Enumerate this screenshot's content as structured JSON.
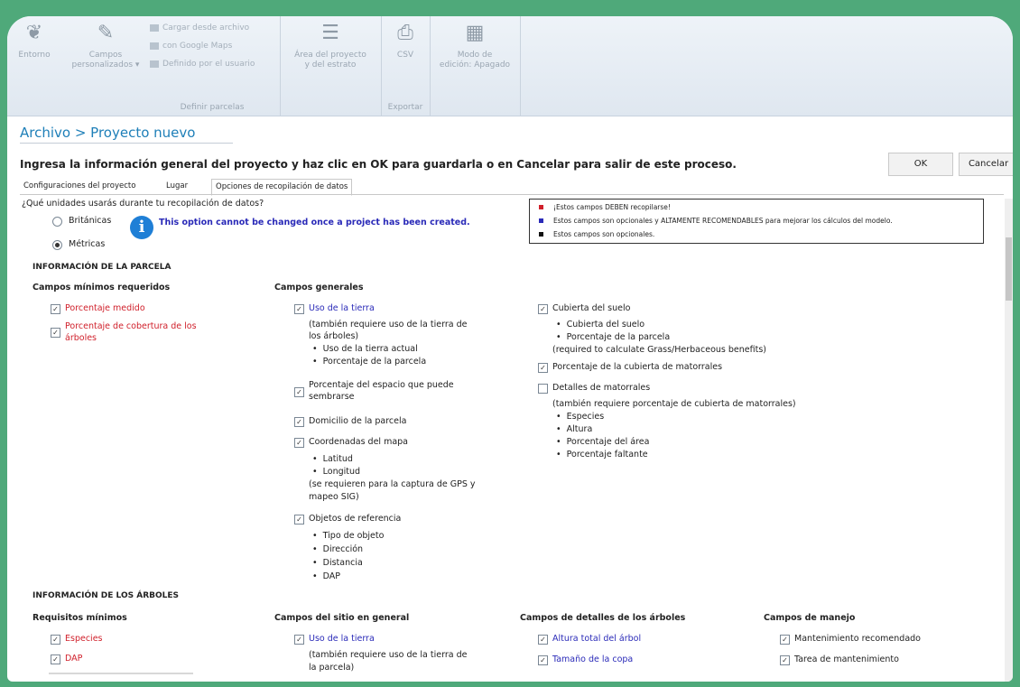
{
  "ribbon": {
    "btn_entorno": "Entorno",
    "btn_campos_line1": "Campos",
    "btn_campos_line2": "personalizados ▾",
    "definir_items": [
      "Cargar desde archivo",
      "con Google Maps",
      "Definido por el usuario"
    ],
    "definir_label": "Definir parcelas",
    "btn_area_line1": "Área del proyecto",
    "btn_area_line2": "y del estrato",
    "btn_csv": "CSV",
    "exportar_label": "Exportar",
    "btn_modo_line1": "Modo de",
    "btn_modo_line2": "edición: Apagado"
  },
  "breadcrumb": "Archivo > Proyecto nuevo",
  "instruction": "Ingresa la información general del proyecto y haz clic en OK para guardarla o en Cancelar para salir de este proceso.",
  "ok_label": "OK",
  "cancel_label": "Cancelar",
  "tabs": [
    "Configuraciones del proyecto",
    "Lugar",
    "Opciones de recopilación de datos"
  ],
  "units": {
    "question_part1": "¿Qué unidades usarás durante tu recopilación de datos?",
    "question": "¿Qué unidades usarás durante tu recopilación de datos?",
    "british": "Británicas",
    "metric": "Métricas",
    "selected": "Métricas",
    "notice": "This option cannot be changed once a project has been created."
  },
  "legend": [
    {
      "text": "¡Estos campos DEBEN recopilarse!",
      "color": "#d0202b"
    },
    {
      "text": "Estos campos son opcionales y ALTAMENTE RECOMENDABLES para mejorar los cálculos del modelo.",
      "color": "#2a2ab8"
    },
    {
      "text": "Estos campos son opcionales.",
      "color": "#111111"
    }
  ],
  "plot": {
    "heading": "INFORMACIÓN DE LA PARCELA",
    "min_heading": "Campos mínimos requeridos",
    "porcentaje_medido": "Porcentaje medido",
    "cobertura_1": "Porcentaje de cobertura de los",
    "cobertura_2": "árboles",
    "general_heading": "Campos generales",
    "uso_tierra": "Uso de la tierra",
    "uso_note_1": "(también requiere uso de la tierra de",
    "uso_note_2": "los árboles)",
    "uso_b1": "Uso de la tierra actual",
    "uso_b2": "Porcentaje de la parcela",
    "espacio_1": "Porcentaje del espacio que puede",
    "espacio_2": "sembrarse",
    "domicilio": "Domicilio de la parcela",
    "coordenadas": "Coordenadas del mapa",
    "latitud": "Latitud",
    "longitud": "Longitud",
    "coord_note_1": "(se requieren para la captura de GPS y",
    "coord_note_2": "mapeo SIG)",
    "objetos": "Objetos de referencia",
    "obj_b1": "Tipo de objeto",
    "obj_b2": "Dirección",
    "obj_b3": "Distancia",
    "obj_b4": "DAP",
    "cubierta": "Cubierta del suelo",
    "cub_b1": "Cubierta del suelo",
    "cub_b2": "Porcentaje de la parcela",
    "cub_note": "(required to calculate Grass/Herbaceous benefits)",
    "matorrales_pct": "Porcentaje de la cubierta de matorrales",
    "detalles_mat": "Detalles de matorrales",
    "det_note": "(también requiere porcentaje de cubierta de matorrales)",
    "det_b1": "Especies",
    "det_b2": "Altura",
    "det_b3": "Porcentaje del área",
    "det_b4": "Porcentaje faltante"
  },
  "trees": {
    "heading": "INFORMACIÓN DE LOS ÁRBOLES",
    "req_heading": "Requisitos mínimos",
    "especies": "Especies",
    "dap": "DAP",
    "site_heading": "Campos del sitio en general",
    "uso_tierra": "Uso de la tierra",
    "uso_note_1": "(también requiere uso de la tierra de",
    "uso_note_2": "la parcela)",
    "detail_heading": "Campos de detalles de los árboles",
    "altura_total": "Altura total del árbol",
    "tamano_copa": "Tamaño de la copa",
    "mgmt_heading": "Campos de manejo",
    "mantenimiento": "Mantenimiento recomendado",
    "tarea": "Tarea de mantenimiento"
  }
}
